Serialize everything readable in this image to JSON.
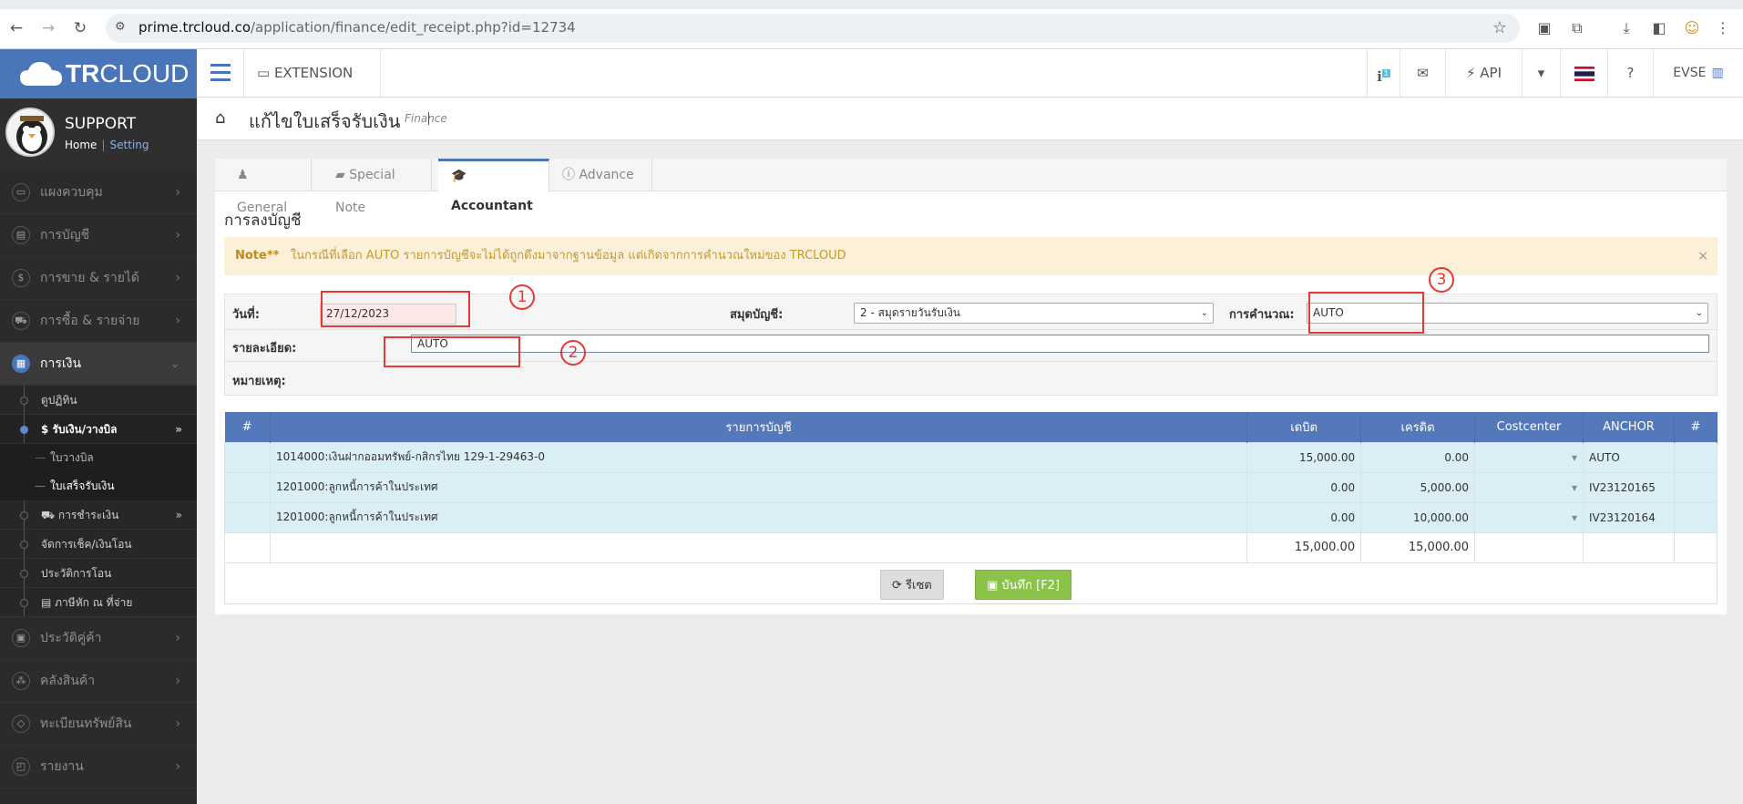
{
  "browser": {
    "url_domain": "prime.trcloud.co",
    "url_path": "/application/finance/edit_receipt.php?id=12734"
  },
  "brand": {
    "logo_bold": "TR",
    "logo_light": "CLOUD"
  },
  "profile": {
    "name": "SUPPORT",
    "home": "Home",
    "setting": "Setting"
  },
  "sidebar": {
    "items": [
      {
        "label": "แผงควบคุม",
        "icon": "monitor-icon"
      },
      {
        "label": "การบัญชี",
        "icon": "book-icon"
      },
      {
        "label": "การขาย & รายได้",
        "icon": "dollar-icon"
      },
      {
        "label": "การซื้อ & รายจ่าย",
        "icon": "cart-icon"
      },
      {
        "label": "การเงิน",
        "icon": "calendar-icon"
      }
    ],
    "finance_sub": [
      {
        "label": "ดูปฏิทิน"
      },
      {
        "label": "$ รับเงิน/วางบิล"
      },
      {
        "label": "ใบวางบิล"
      },
      {
        "label": "ใบเสร็จรับเงิน"
      },
      {
        "label": "การชำระเงิน"
      },
      {
        "label": "จัดการเช็ค/เงินโอน"
      },
      {
        "label": "ประวัติการโอน"
      },
      {
        "label": "ภาษีหัก ณ ที่จ่าย"
      }
    ],
    "items_after": [
      {
        "label": "ประวัติคู่ค้า",
        "icon": "contact-icon"
      },
      {
        "label": "คลังสินค้า",
        "icon": "warehouse-icon"
      },
      {
        "label": "ทะเบียนทรัพย์สิน",
        "icon": "diamond-icon"
      },
      {
        "label": "รายงาน",
        "icon": "report-icon"
      }
    ]
  },
  "topbar": {
    "extension": "EXTENSION",
    "api": "API",
    "company": "EVSE",
    "info_badge": "1"
  },
  "page": {
    "title": "แก้ไขใบเสร็จรับเงิน",
    "module": "Finance"
  },
  "tabs": [
    "General",
    "Special Note",
    "Accountant",
    "Advance"
  ],
  "accountant": {
    "section_title": "การลงบัญชี",
    "note_label": "Note**",
    "note_text": "ในกรณีที่เลือก AUTO รายการบัญชีจะไม่ได้ถูกดึงมาจากฐานข้อมูล แต่เกิดจากการคำนวณใหม่ของ TRCLOUD",
    "date_label": "วันที่:",
    "date_value": "27/12/2023",
    "book_label": "สมุดบัญชี:",
    "book_value": "2 - สมุดรายวันรับเงิน",
    "calc_label": "การคำนวณ:",
    "calc_value": "AUTO",
    "detail_label": "รายละเอียด:",
    "detail_value": "AUTO",
    "remark_label": "หมายเหตุ:",
    "markers": [
      "1",
      "2",
      "3"
    ]
  },
  "grid": {
    "headers": [
      "#",
      "รายการบัญชี",
      "เดบิต",
      "เครดิต",
      "Costcenter",
      "ANCHOR",
      "#"
    ],
    "rows": [
      {
        "account": "1014000:เงินฝากออมทรัพย์-กสิกรไทย 129-1-29463-0",
        "debit": "15,000.00",
        "credit": "0.00",
        "anchor": "AUTO"
      },
      {
        "account": "1201000:ลูกหนี้การค้าในประเทศ",
        "debit": "0.00",
        "credit": "5,000.00",
        "anchor": "IV23120165"
      },
      {
        "account": "1201000:ลูกหนี้การค้าในประเทศ",
        "debit": "0.00",
        "credit": "10,000.00",
        "anchor": "IV23120164"
      }
    ],
    "total_debit": "15,000.00",
    "total_credit": "15,000.00"
  },
  "buttons": {
    "reset": "รีเซต",
    "save": "บันทึก [F2]"
  }
}
